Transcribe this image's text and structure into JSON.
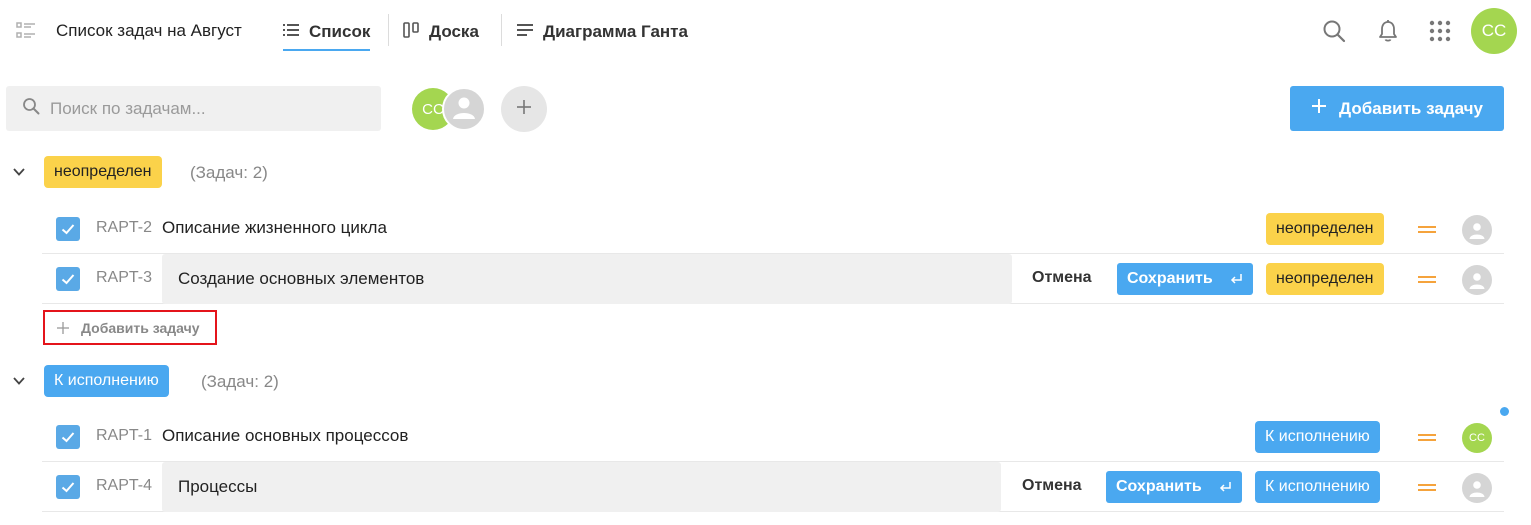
{
  "header": {
    "project_title": "Список задач на Август",
    "tabs": [
      {
        "label": "Список",
        "icon": "list-icon",
        "active": true
      },
      {
        "label": "Доска",
        "icon": "board-icon",
        "active": false
      },
      {
        "label": "Диаграмма Ганта",
        "icon": "gantt-icon",
        "active": false
      }
    ],
    "user_initials": "CC"
  },
  "toolbar": {
    "search_placeholder": "Поиск по задачам...",
    "members": [
      {
        "initials": "CC",
        "color": "#a4d650"
      },
      {
        "initials": "",
        "color": "#d5d5d5"
      }
    ],
    "add_task_label": "Добавить задачу"
  },
  "groups": [
    {
      "status": "неопределен",
      "count_label": "(Задач: 2)",
      "tasks": [
        {
          "key": "RAPT-2",
          "title": "Описание жизненного цикла",
          "editing": false,
          "status": "неопределен",
          "priority": "medium",
          "assignee": ""
        },
        {
          "key": "RAPT-3",
          "title": "Создание основных элементов",
          "editing": true,
          "cancel_label": "Отмена",
          "save_label": "Сохранить",
          "status": "неопределен",
          "priority": "medium",
          "assignee": ""
        }
      ],
      "add_task_label": "Добавить задачу"
    },
    {
      "status": "К исполнению",
      "count_label": "(Задач: 2)",
      "tasks": [
        {
          "key": "RAPT-1",
          "title": "Описание основных процессов",
          "editing": false,
          "status": "К исполнению",
          "priority": "medium",
          "assignee": "CC"
        },
        {
          "key": "RAPT-4",
          "title": "Процессы",
          "editing": true,
          "cancel_label": "Отмена",
          "save_label": "Сохранить",
          "status": "К исполнению",
          "priority": "medium",
          "assignee": ""
        }
      ]
    }
  ],
  "colors": {
    "accent": "#4aa8f0",
    "status_undefined": "#fbd24a",
    "status_todo": "#4aa8f0",
    "priority_medium": "#f5a33c",
    "avatar_green": "#a4d650",
    "highlight_border": "#e4141b"
  }
}
